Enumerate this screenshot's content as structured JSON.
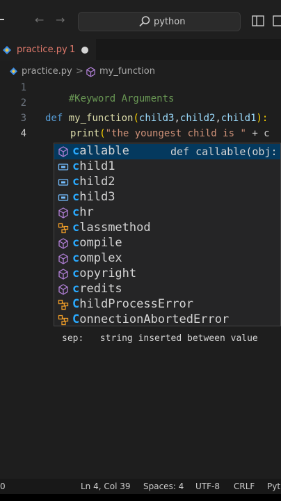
{
  "titlebar": {
    "search_text": "python"
  },
  "tab": {
    "file_name": "practice.py",
    "problem_count": "1"
  },
  "breadcrumb": {
    "file": "practice.py",
    "separator": ">",
    "symbol": "my_function"
  },
  "editor": {
    "line_numbers": [
      "1",
      "2",
      "3",
      "4"
    ],
    "line1_comment": "#Keyword Arguments",
    "line3": {
      "kw_def": "def",
      "fn_name": "my_function",
      "open": "(",
      "p1": "child3",
      "c1": ",",
      "p2": "child2",
      "c2": ",",
      "p3": "child1",
      "close": "):"
    },
    "line4": {
      "fn": "print",
      "open": "(",
      "str": "\"the youngest child is \"",
      "op": " + c"
    }
  },
  "suggestions": [
    {
      "match": "c",
      "rest": "allable",
      "kind": "cube",
      "detail": "def callable(obj:"
    },
    {
      "match": "c",
      "rest": "hild1",
      "kind": "variable"
    },
    {
      "match": "c",
      "rest": "hild2",
      "kind": "variable"
    },
    {
      "match": "c",
      "rest": "hild3",
      "kind": "variable"
    },
    {
      "match": "c",
      "rest": "hr",
      "kind": "cube"
    },
    {
      "match": "c",
      "rest": "lassmethod",
      "kind": "class"
    },
    {
      "match": "c",
      "rest": "ompile",
      "kind": "cube"
    },
    {
      "match": "c",
      "rest": "omplex",
      "kind": "cube"
    },
    {
      "match": "c",
      "rest": "opyright",
      "kind": "cube"
    },
    {
      "match": "c",
      "rest": "redits",
      "kind": "cube"
    },
    {
      "match": "C",
      "rest": "hildProcessError",
      "kind": "class"
    },
    {
      "match": "C",
      "rest": "onnectionAbortedError",
      "kind": "class"
    }
  ],
  "param_hint": "sep:   string inserted between value",
  "statusbar": {
    "problems": "0",
    "position": "Ln 4, Col 39",
    "spaces": "Spaces: 4",
    "encoding": "UTF-8",
    "eol": "CRLF",
    "language": "Pyt"
  },
  "colors": {
    "selected_bg": "#04395e",
    "match": "#2aaaff",
    "cube_icon": "#b180d7",
    "variable_icon": "#75beff",
    "class_icon": "#ee9d28",
    "error": "#e17a6c"
  }
}
